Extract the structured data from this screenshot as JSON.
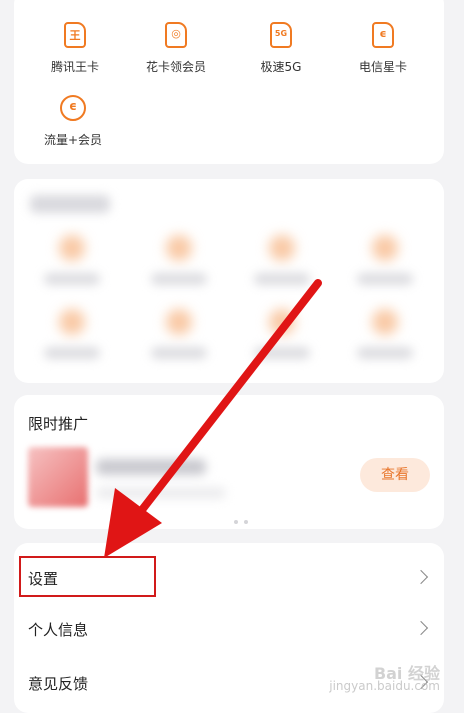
{
  "top_grid": {
    "items": [
      {
        "label": "腾讯王卡",
        "icon": "sim-card-wang-icon",
        "glyph": "王"
      },
      {
        "label": "花卡领会员",
        "icon": "sim-card-hua-icon",
        "glyph": "◎"
      },
      {
        "label": "极速5G",
        "icon": "sim-card-5g-icon",
        "glyph": "5G"
      },
      {
        "label": "电信星卡",
        "icon": "sim-card-dianxin-icon",
        "glyph": "ϵ"
      },
      {
        "label": "流量+会员",
        "icon": "traffic-member-icon",
        "glyph": "ϵ"
      }
    ]
  },
  "promo": {
    "title": "限时推广",
    "view_button": "查看"
  },
  "menu": {
    "items": [
      {
        "label": "设置"
      },
      {
        "label": "个人信息"
      },
      {
        "label": "意见反馈"
      }
    ]
  },
  "annotation": {
    "arrow_color": "#e01515",
    "box_color": "#d11a1a"
  },
  "watermark": {
    "brand": "Bai 经验",
    "url": "jingyan.baidu.com"
  },
  "colors": {
    "accent": "#f07a22",
    "background": "#f3f3f5"
  }
}
